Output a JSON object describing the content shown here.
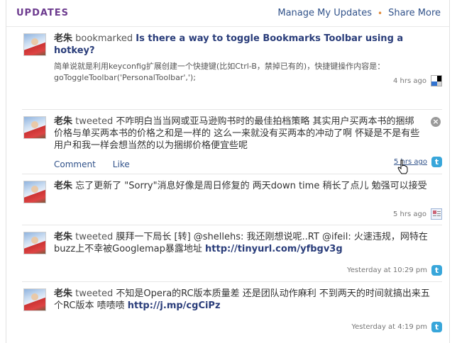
{
  "header": {
    "title": "UPDATES",
    "manage_link": "Manage My Updates",
    "separator": "•",
    "share_link": "Share More"
  },
  "items": [
    {
      "name": "老朱",
      "verb": "bookmarked",
      "link_text": "Is there a way to toggle Bookmarks Toolbar using a hotkey?",
      "excerpt": "简单说就是利用keyconfig扩展创建一个快捷键(比如Ctrl-B，禁掉已有的)，快捷键操作内容是：goToggleToolbar('PersonalToolbar',');",
      "time": "4 hrs ago",
      "service_icon": "delicious-icon"
    },
    {
      "name": "老朱",
      "verb": "tweeted",
      "text": "不咋明白当当网或亚马逊购书时的最佳拍档策略 其实用户买两本书的捆绑价格与单买两本书的价格之和是一样的 这么一来就没有买两本的冲动了啊 怀疑是不是有些用户和我一样会想当然的以为捆绑价格便宜些呢",
      "comment_label": "Comment",
      "like_label": "Like",
      "time": "5 hrs ago",
      "service_icon": "twitter-icon",
      "close_symbol": "×"
    },
    {
      "name": "老朱",
      "text": "忘了更新了 \"Sorry\"消息好像是周日修复的 两天down time 稍长了点儿 勉强可以接受",
      "time": "5 hrs ago",
      "service_icon": "status-icon"
    },
    {
      "name": "老朱",
      "verb": "tweeted",
      "text": "膜拜一下局长 [转] @shellehs: 我还刚想说呢..RT @ifeil: 火速违规，网特在buzz上不幸被Googlemap暴露地址",
      "url": "http://tinyurl.com/yfbgv3g",
      "time": "Yesterday at 10:29 pm",
      "service_icon": "twitter-icon"
    },
    {
      "name": "老朱",
      "verb": "tweeted",
      "text": "不知是Opera的RC版本质量差 还是团队动作麻利 不到两天的时间就搞出来五个RC版本 啧啧啧",
      "url": "http://j.mp/cgCiPz",
      "time": "Yesterday at 4:19 pm",
      "service_icon": "twitter-icon"
    }
  ],
  "icons": {
    "twitter_glyph": "t"
  }
}
